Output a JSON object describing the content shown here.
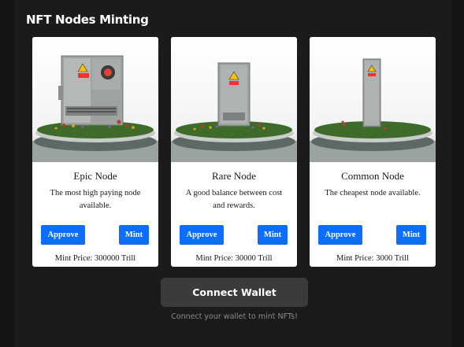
{
  "header": {
    "title": "NFT Nodes Minting"
  },
  "cards": [
    {
      "name": "Epic Node",
      "description": "The most high paying node available.",
      "approve_label": "Approve",
      "mint_label": "Mint",
      "price": "Mint Price: 300000 Trill",
      "image_icon": "utility-cabinet-large-image"
    },
    {
      "name": "Rare Node",
      "description": "A good balance between cost and rewards.",
      "approve_label": "Approve",
      "mint_label": "Mint",
      "price": "Mint Price: 30000 Trill",
      "image_icon": "utility-cabinet-medium-image"
    },
    {
      "name": "Common Node",
      "description": "The cheapest node available.",
      "approve_label": "Approve",
      "mint_label": "Mint",
      "price": "Mint Price: 3000 Trill",
      "image_icon": "utility-cabinet-small-image"
    }
  ],
  "wallet": {
    "connect_label": "Connect Wallet",
    "hint": "Connect your wallet to mint NFTs!"
  },
  "colors": {
    "page_bg": "#141416",
    "panel_bg": "#1b1b1d",
    "button_blue": "#0d6efd",
    "connect_bg": "#3b3b3e",
    "hint_text": "#8a8a8e"
  }
}
